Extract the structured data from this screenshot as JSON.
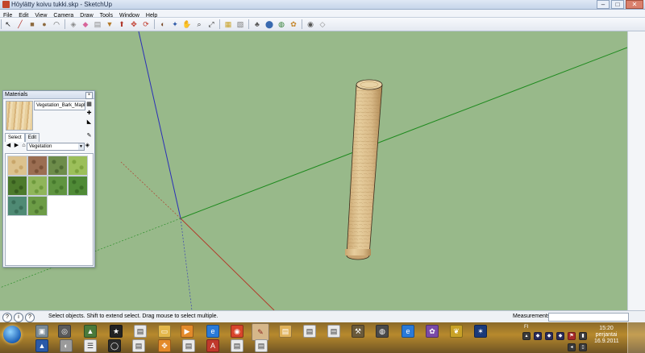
{
  "window": {
    "title": "Höylätty koivu tukki.skp - SketchUp",
    "controls": [
      "–",
      "□",
      "✕"
    ]
  },
  "menu": [
    "File",
    "Edit",
    "View",
    "Camera",
    "Draw",
    "Tools",
    "Window",
    "Help"
  ],
  "toolbar": {
    "tools": [
      {
        "name": "select-tool-icon",
        "glyph": "↖",
        "color": "#222222"
      },
      {
        "name": "line-tool-icon",
        "glyph": "╱",
        "color": "#b2312a"
      },
      {
        "name": "rectangle-tool-icon",
        "glyph": "■",
        "color": "#8d6a3f"
      },
      {
        "name": "circle-tool-icon",
        "glyph": "●",
        "color": "#8d6a3f"
      },
      {
        "name": "arc-tool-icon",
        "glyph": "◠",
        "color": "#555555"
      },
      {
        "name": "make-component-icon",
        "glyph": "◈",
        "color": "#8a8a8a"
      },
      {
        "name": "eraser-tool-icon",
        "glyph": "◆",
        "color": "#d8659a"
      },
      {
        "name": "tape-measure-icon",
        "glyph": "▤",
        "color": "#888888"
      },
      {
        "name": "paint-bucket-icon",
        "glyph": "▼",
        "color": "#b47a2a"
      },
      {
        "name": "push-pull-icon",
        "glyph": "⬆",
        "color": "#b13a2f"
      },
      {
        "name": "move-tool-icon",
        "glyph": "✥",
        "color": "#c0392b"
      },
      {
        "name": "rotate-tool-icon",
        "glyph": "⟳",
        "color": "#c0392b"
      },
      {
        "name": "offset-tool-icon",
        "glyph": "◐",
        "color": "#7a4a2a"
      },
      {
        "name": "orbit-tool-icon",
        "glyph": "✦",
        "color": "#2e5aa8"
      },
      {
        "name": "pan-tool-icon",
        "glyph": "✋",
        "color": "#7a5a3a"
      },
      {
        "name": "zoom-tool-icon",
        "glyph": "⌕",
        "color": "#333333"
      },
      {
        "name": "zoom-extents-icon",
        "glyph": "⤢",
        "color": "#333333"
      },
      {
        "name": "get-models-icon",
        "glyph": "▦",
        "color": "#c9a227"
      },
      {
        "name": "share-model-icon",
        "glyph": "▧",
        "color": "#7a7a7a"
      },
      {
        "name": "components-icon",
        "glyph": "♣",
        "color": "#5a5a5a"
      },
      {
        "name": "materials-icon",
        "glyph": "⬤",
        "color": "#3a6ab0"
      },
      {
        "name": "google-earth-icon",
        "glyph": "◍",
        "color": "#2e7d32"
      },
      {
        "name": "extension-tool-icon",
        "glyph": "✿",
        "color": "#c4852a"
      },
      {
        "name": "photo-texture-icon",
        "glyph": "◉",
        "color": "#555555"
      },
      {
        "name": "layout-icon",
        "glyph": "◇",
        "color": "#888888"
      }
    ]
  },
  "materials_panel": {
    "title": "Materials",
    "material_name": "Vegetation_Bark_Maple",
    "tabs": [
      "Select",
      "Edit"
    ],
    "library": "Vegetation",
    "swatches": [
      {
        "name": "swatch-bark-maple",
        "color": "#dcc28e",
        "accent": "#c8a66a"
      },
      {
        "name": "swatch-bark-rough",
        "color": "#9b6e52",
        "accent": "#7c5238"
      },
      {
        "name": "swatch-groundcover",
        "color": "#6d8c4a",
        "accent": "#4f6c34"
      },
      {
        "name": "swatch-grass-light",
        "color": "#9cbf5a",
        "accent": "#7ea43e"
      },
      {
        "name": "swatch-leaves-dark",
        "color": "#4d7a2c",
        "accent": "#375c1e"
      },
      {
        "name": "swatch-leaves-light",
        "color": "#8fb55a",
        "accent": "#6e9a3c"
      },
      {
        "name": "swatch-hedge",
        "color": "#5f9440",
        "accent": "#477a2d"
      },
      {
        "name": "swatch-ivy",
        "color": "#4f8a36",
        "accent": "#3a6e26"
      },
      {
        "name": "swatch-shrub-blue",
        "color": "#4f8a74",
        "accent": "#3a6e5a"
      },
      {
        "name": "swatch-moss",
        "color": "#6c9c46",
        "accent": "#507a32"
      }
    ]
  },
  "status": {
    "message": "Select objects. Shift to extend select. Drag mouse to select multiple.",
    "measurements_label": "Measurements"
  },
  "taskbar": {
    "language": "FI",
    "time": "15:20",
    "day": "perjantai",
    "date": "16.9.2011"
  },
  "colors": {
    "viewport": "#98b98a",
    "axis_blue": "#2a2fb8",
    "axis_green": "#1e8a1e",
    "axis_red": "#b23a2a",
    "log_wood": "#d8b987"
  }
}
